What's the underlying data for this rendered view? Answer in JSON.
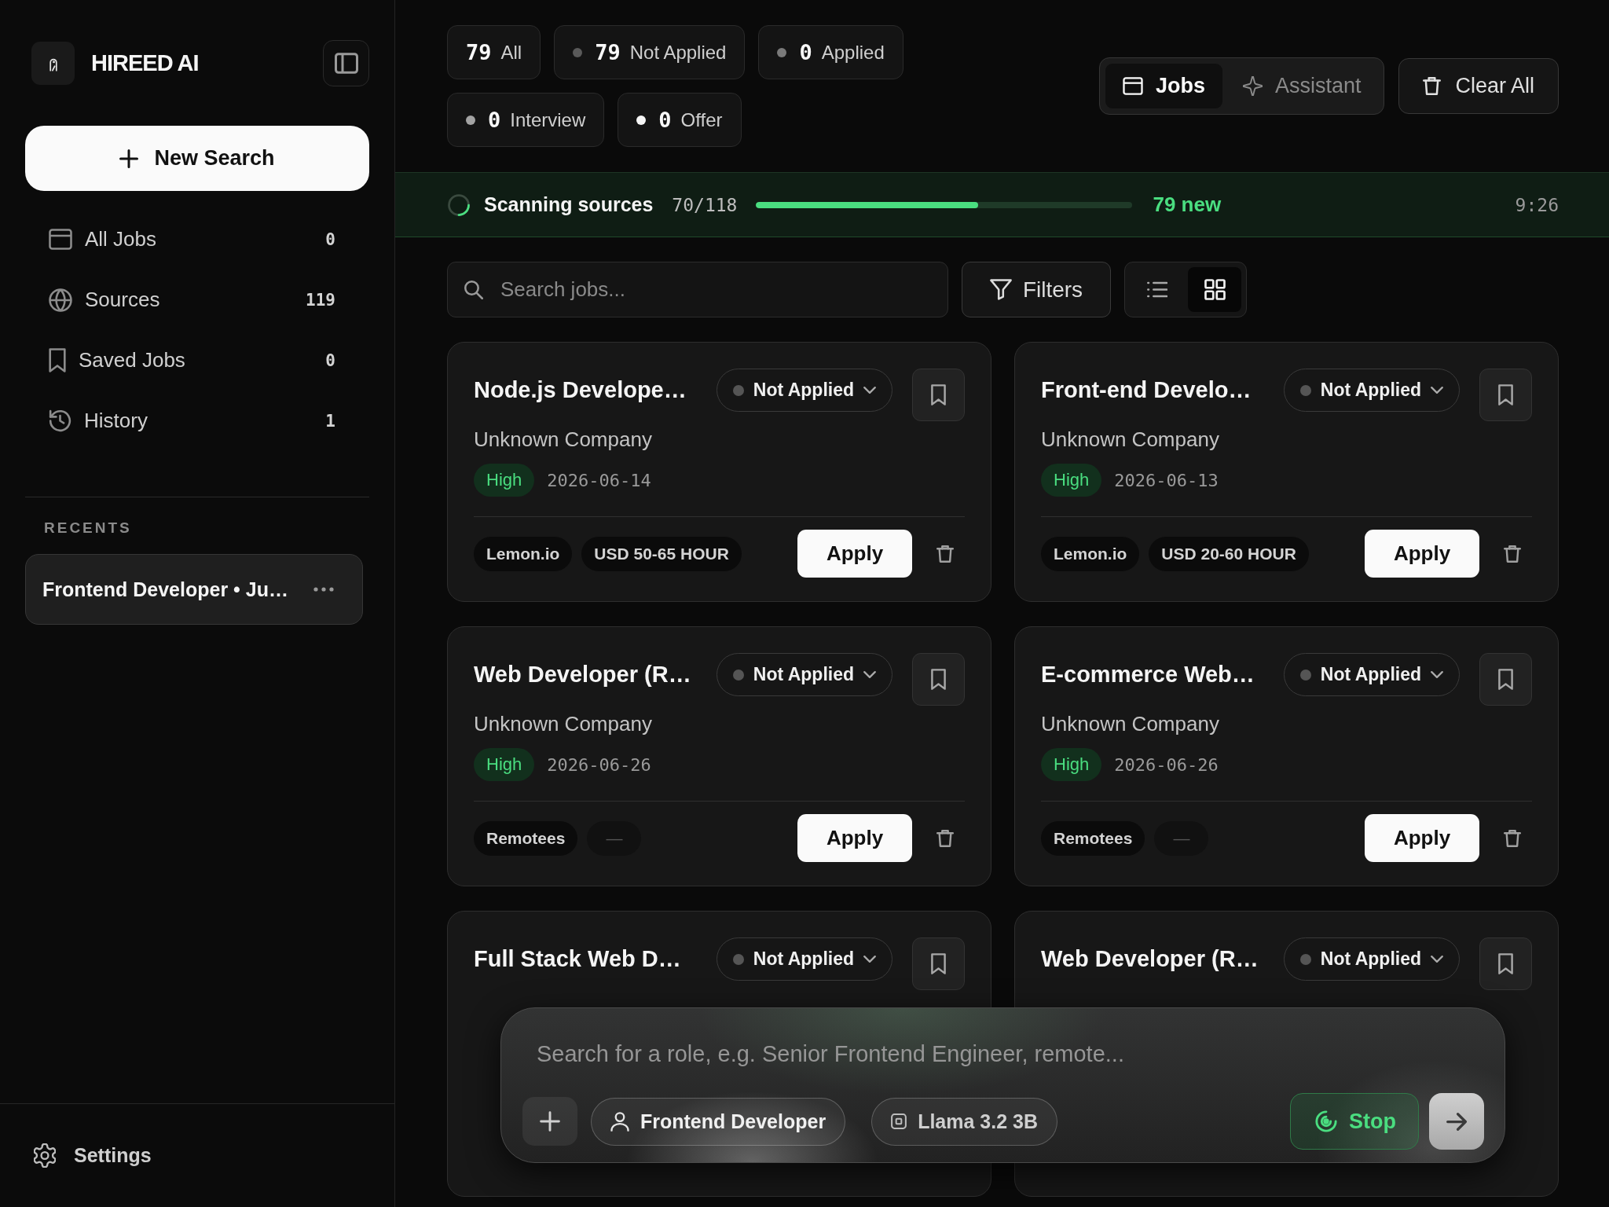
{
  "sidebar": {
    "brand": "HIREED AI",
    "new_search": "New Search",
    "nav": [
      {
        "label": "All Jobs",
        "count": "0",
        "selected": false
      },
      {
        "label": "Sources",
        "count": "119",
        "selected": false
      },
      {
        "label": "Saved Jobs",
        "count": "0",
        "selected": false
      },
      {
        "label": "History",
        "count": "1",
        "selected": false
      }
    ],
    "recents_heading": "RECENTS",
    "recents": [
      {
        "title": "Frontend Developer • Ju…",
        "selected": true
      }
    ],
    "settings": "Settings"
  },
  "stats": [
    {
      "count": "79",
      "label": "All"
    },
    {
      "count": "79",
      "label": "Not Applied",
      "color": "#5a5a5a"
    },
    {
      "count": "0",
      "label": "Applied",
      "color": "#7a7a7a"
    },
    {
      "count": "0",
      "label": "Interview",
      "color": "#a3a3a3"
    },
    {
      "count": "0",
      "label": "Offer",
      "color": "#f5f5f5"
    }
  ],
  "mode_tabs": [
    {
      "label": "Jobs",
      "selected": true
    },
    {
      "label": "Assistant",
      "selected": false
    }
  ],
  "clear_all": "Clear All",
  "scan": {
    "label": "Scanning sources",
    "progress": "70/118",
    "level": 0.59,
    "new_count": "79 new",
    "elapsed": "9:26"
  },
  "search": {
    "placeholder": "Search jobs..."
  },
  "filters": "Filters",
  "view_toggle": [
    {
      "kind": "list",
      "selected": false
    },
    {
      "kind": "grid",
      "selected": true
    }
  ],
  "jobs": [
    {
      "title": "Node.js Develope…",
      "status": "Not Applied",
      "saved": false,
      "company": "Unknown Company",
      "priority": "High",
      "date": "2026-06-14",
      "tags": [
        {
          "kind": "source",
          "text": "Lemon.io"
        },
        {
          "kind": "salary",
          "text": "USD 50-65 HOUR"
        }
      ],
      "action": "Apply"
    },
    {
      "title": "Front-end Develo…",
      "status": "Not Applied",
      "saved": false,
      "company": "Unknown Company",
      "priority": "High",
      "date": "2026-06-13",
      "tags": [
        {
          "kind": "source",
          "text": "Lemon.io"
        },
        {
          "kind": "salary",
          "text": "USD 20-60 HOUR"
        }
      ],
      "action": "Apply"
    },
    {
      "title": "Web Developer (R…",
      "status": "Not Applied",
      "saved": false,
      "company": "Unknown Company",
      "priority": "High",
      "date": "2026-06-26",
      "tags": [
        {
          "kind": "source",
          "text": "Remotees"
        },
        {
          "kind": "missing",
          "text": "—"
        }
      ],
      "action": "Apply"
    },
    {
      "title": "E-commerce Web…",
      "status": "Not Applied",
      "saved": false,
      "company": "Unknown Company",
      "priority": "High",
      "date": "2026-06-26",
      "tags": [
        {
          "kind": "source",
          "text": "Remotees"
        },
        {
          "kind": "missing",
          "text": "—"
        }
      ],
      "action": "Apply"
    },
    {
      "title": "Full Stack Web D…",
      "status": "Not Applied",
      "saved": false
    },
    {
      "title": "Web Developer (R…",
      "status": "Not Applied",
      "saved": false
    }
  ],
  "composer": {
    "placeholder": "Search for a role, e.g. Senior Frontend Engineer, remote...",
    "chips": [
      {
        "kind": "role",
        "label": "Frontend Developer"
      },
      {
        "kind": "model",
        "label": "Llama 3.2 3B"
      }
    ],
    "stop": "Stop"
  }
}
